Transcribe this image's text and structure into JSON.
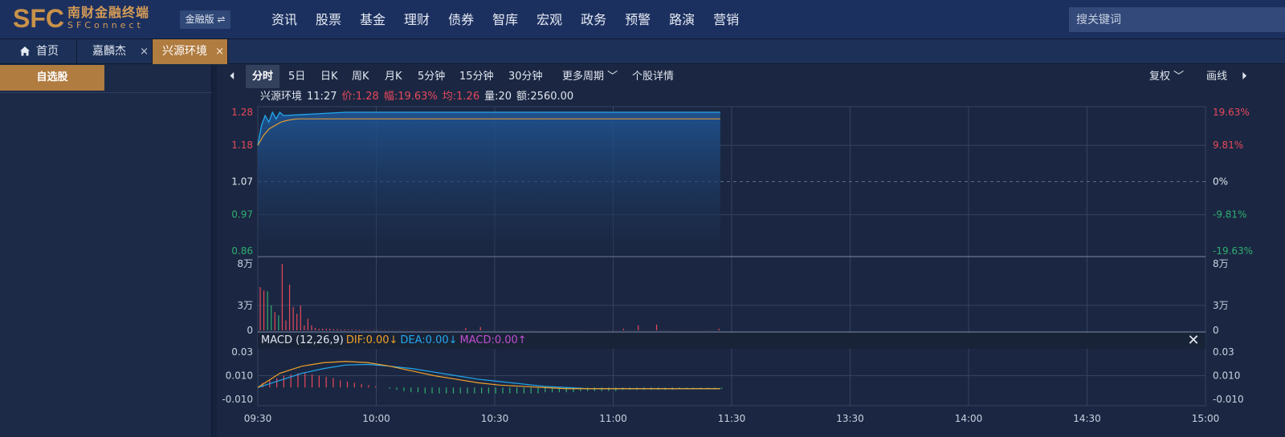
{
  "header": {
    "logo_letters": "SFC",
    "logo_cn": "南财金融终端",
    "logo_en": "SFConnect",
    "edition_label": "金融版 ⇌",
    "nav": [
      "资讯",
      "股票",
      "基金",
      "理财",
      "债券",
      "智库",
      "宏观",
      "政务",
      "预警",
      "路演",
      "营销"
    ],
    "search_placeholder": "搜关键词"
  },
  "tabs": {
    "home": "首页",
    "items": [
      {
        "label": "嘉麟杰",
        "close": "×"
      },
      {
        "label": "兴源环境",
        "close": "×"
      }
    ]
  },
  "sidebar": {
    "watchlist_button": "自选股"
  },
  "period_bar": {
    "prev": "⏴",
    "periods": [
      "分时",
      "5日",
      "日K",
      "周K",
      "月K",
      "5分钟",
      "15分钟",
      "30分钟"
    ],
    "active": "分时",
    "more": "更多周期",
    "detail": "个股详情",
    "adjust": "复权",
    "draw": "画线",
    "next": "⏵"
  },
  "quote": {
    "name": "兴源环境",
    "time": "11:27",
    "price": "价:1.28",
    "change": "幅:19.63%",
    "avg": "均:1.26",
    "volume": "量:20",
    "amount": "额:2560.00"
  },
  "macd": {
    "title": "MACD (12,26,9)",
    "dif": "DIF:0.00↓",
    "dea": "DEA:0.00↓",
    "macd": "MACD:0.00↑",
    "close": "✕"
  },
  "colors": {
    "up": "#e8485a",
    "down": "#2fae6f",
    "price_line": "#22a8ef",
    "avg_line": "#f0a22a",
    "dif_line": "#f0a22a",
    "dea_line": "#22a8ef"
  },
  "chart_data": [
    {
      "type": "line",
      "y_left_ticks": [
        "1.28",
        "1.18",
        "1.07",
        "0.97",
        "0.86"
      ],
      "y_right_ticks": [
        "19.63%",
        "9.81%",
        "0%",
        "-9.81%",
        "-19.63%"
      ],
      "ylim": [
        0.86,
        1.28
      ],
      "base": 1.07,
      "x_ticks": [
        "09:30",
        "10:00",
        "10:30",
        "11:00",
        "11:30",
        "13:30",
        "14:00",
        "14:30",
        "15:00"
      ],
      "series": [
        {
          "values": [
            1.18,
            1.24,
            1.27,
            1.25,
            1.28,
            1.26,
            1.28,
            1.27,
            1.28,
            1.28,
            1.28,
            1.28,
            1.28,
            1.28,
            1.28
          ]
        },
        {
          "values": [
            1.18,
            1.21,
            1.23,
            1.24,
            1.25,
            1.255,
            1.258,
            1.26,
            1.26,
            1.26,
            1.26,
            1.26
          ]
        }
      ]
    },
    {
      "type": "bar",
      "y_left_ticks": [
        "8万",
        "3万",
        "0"
      ],
      "y_right_ticks": [
        "8万",
        "3万",
        "0"
      ],
      "ylim": [
        0,
        80000
      ],
      "values": [
        52000,
        48000,
        47000,
        30000,
        22000,
        18000,
        80000,
        12000,
        55000,
        28000,
        20000,
        30000,
        6000,
        14000,
        6000,
        3000,
        2000,
        2000,
        2000,
        2000,
        1500,
        1500,
        1000,
        1000,
        1000,
        1000,
        800,
        800,
        600,
        600,
        500,
        500,
        500,
        400,
        400,
        400,
        300,
        300,
        300,
        200,
        200,
        200,
        200,
        200,
        200,
        200,
        200,
        200,
        200,
        200,
        200,
        200,
        200,
        200,
        200,
        200,
        3000,
        200,
        200,
        200,
        4000,
        200,
        200,
        200,
        200,
        200,
        200,
        200,
        200,
        200,
        200,
        200,
        200,
        200,
        200,
        200,
        200,
        200,
        200,
        200,
        200,
        200,
        200,
        200,
        200,
        200,
        200,
        200,
        200,
        200,
        200,
        200,
        200,
        200,
        200,
        200,
        200,
        200,
        200,
        2000,
        200,
        200,
        200,
        6000,
        200,
        200,
        200,
        200,
        7000,
        200,
        200,
        200,
        200,
        200,
        200,
        200,
        200,
        200,
        200,
        200,
        200,
        200,
        200,
        200,
        200,
        2000
      ],
      "colors": [
        "up",
        "up",
        "down",
        "down",
        "up",
        "down",
        "up",
        "up",
        "up",
        "up",
        "up",
        "up",
        "up",
        "up",
        "up",
        "up",
        "up",
        "up",
        "up",
        "up",
        "up",
        "up",
        "up",
        "up",
        "up",
        "up",
        "up",
        "up",
        "up",
        "up",
        "up",
        "up",
        "up",
        "up",
        "up",
        "up",
        "up",
        "up",
        "up",
        "up",
        "up",
        "up",
        "up",
        "up",
        "up",
        "up",
        "up",
        "up",
        "up",
        "up",
        "up",
        "up",
        "up",
        "up",
        "up",
        "up",
        "up",
        "up",
        "up",
        "up",
        "up",
        "up",
        "up",
        "up",
        "up",
        "up",
        "up",
        "up",
        "up",
        "up",
        "up",
        "up",
        "up",
        "up",
        "up",
        "up",
        "up",
        "up",
        "up",
        "up",
        "up",
        "up",
        "up",
        "up",
        "up",
        "up",
        "up",
        "up",
        "up",
        "up",
        "up",
        "up",
        "up",
        "up",
        "up",
        "up",
        "up",
        "up",
        "up",
        "up",
        "up",
        "up",
        "up",
        "up",
        "up",
        "up",
        "up",
        "up",
        "up",
        "up",
        "up",
        "up",
        "up",
        "up",
        "up",
        "up",
        "up",
        "up",
        "up",
        "up",
        "up",
        "up",
        "up",
        "up",
        "up",
        "up"
      ]
    },
    {
      "type": "line",
      "y_left_ticks": [
        "0.03",
        "0.010",
        "-0.010"
      ],
      "y_right_ticks": [
        "0.03",
        "0.010",
        "-0.010"
      ],
      "ylim": [
        -0.012,
        0.032
      ],
      "series": [
        {
          "values": [
            0.0,
            0.012,
            0.018,
            0.021,
            0.022,
            0.021,
            0.018,
            0.014,
            0.01,
            0.007,
            0.004,
            0.002,
            0.001,
            0.0,
            -0.001,
            -0.001,
            -0.001,
            -0.001,
            -0.001,
            -0.001,
            -0.001,
            -0.001
          ]
        },
        {
          "values": [
            0.0,
            0.006,
            0.012,
            0.016,
            0.019,
            0.0195,
            0.018,
            0.016,
            0.013,
            0.01,
            0.007,
            0.005,
            0.003,
            0.001,
            0.0,
            -0.001,
            -0.001,
            -0.001,
            -0.001,
            -0.001,
            -0.001,
            -0.001
          ]
        }
      ],
      "histogram": [
        0.004,
        0.006,
        0.008,
        0.01,
        0.011,
        0.012,
        0.012,
        0.011,
        0.01,
        0.009,
        0.008,
        0.006,
        0.005,
        0.004,
        0.003,
        0.002,
        0.001,
        0.0,
        -0.001,
        -0.002,
        -0.003,
        -0.004,
        -0.004,
        -0.005,
        -0.005,
        -0.005,
        -0.005,
        -0.005,
        -0.005,
        -0.005,
        -0.005,
        -0.005,
        -0.005,
        -0.005,
        -0.005,
        -0.005,
        -0.005,
        -0.005,
        -0.005,
        -0.005,
        -0.004,
        -0.004,
        -0.004,
        -0.004,
        -0.004,
        -0.003,
        -0.003,
        -0.003,
        -0.003,
        -0.003,
        -0.003,
        -0.002,
        -0.002,
        -0.002,
        -0.002,
        -0.002,
        -0.002,
        -0.002,
        -0.002,
        -0.001,
        -0.001,
        -0.001,
        -0.001,
        -0.001,
        -0.001,
        -0.001
      ]
    }
  ]
}
